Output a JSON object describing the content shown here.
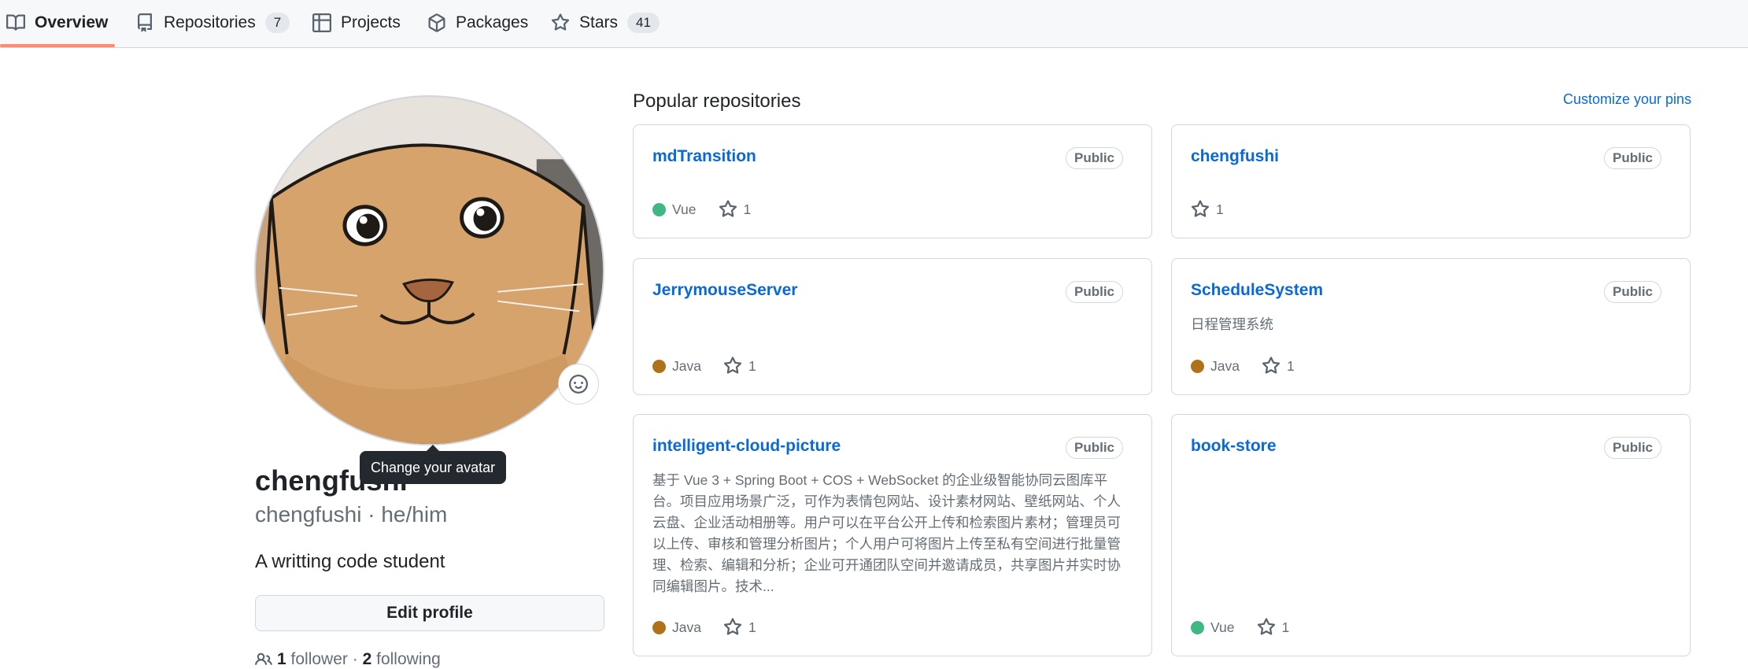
{
  "nav": {
    "tabs": [
      {
        "label": "Overview",
        "icon": "book-icon",
        "selected": true
      },
      {
        "label": "Repositories",
        "icon": "repo-icon",
        "count": "7"
      },
      {
        "label": "Projects",
        "icon": "table-icon"
      },
      {
        "label": "Packages",
        "icon": "package-icon"
      },
      {
        "label": "Stars",
        "icon": "star-icon",
        "count": "41"
      }
    ],
    "accent_color": "#fd8c73"
  },
  "profile": {
    "tooltip": "Change your avatar",
    "fullname": "chengfushi",
    "login": "chengfushi · he/him",
    "bio": "A writting code student",
    "edit_label": "Edit profile",
    "followers_count": "1",
    "followers_label": "follower",
    "separator": "·",
    "following_count": "2",
    "following_label": "following"
  },
  "popular": {
    "title": "Popular repositories",
    "customize_label": "Customize your pins",
    "repos": [
      {
        "name": "mdTransition",
        "visibility": "Public",
        "description": "",
        "language": "Vue",
        "lang_color": "#41b883",
        "stars": "1"
      },
      {
        "name": "chengfushi",
        "visibility": "Public",
        "description": "",
        "language": "",
        "lang_color": "",
        "stars": "1"
      },
      {
        "name": "JerrymouseServer",
        "visibility": "Public",
        "description": "",
        "language": "Java",
        "lang_color": "#b07219",
        "stars": "1"
      },
      {
        "name": "ScheduleSystem",
        "visibility": "Public",
        "description": "日程管理系统",
        "language": "Java",
        "lang_color": "#b07219",
        "stars": "1"
      },
      {
        "name": "intelligent-cloud-picture",
        "visibility": "Public",
        "description": "基于 Vue 3 + Spring Boot + COS + WebSocket 的企业级智能协同云图库平台。项目应用场景广泛，可作为表情包网站、设计素材网站、壁纸网站、个人云盘、企业活动相册等。用户可以在平台公开上传和检索图片素材；管理员可以上传、审核和管理分析图片；个人用户可将图片上传至私有空间进行批量管理、检索、编辑和分析；企业可开通团队空间并邀请成员，共享图片并实时协同编辑图片。技术...",
        "language": "Java",
        "lang_color": "#b07219",
        "stars": "1"
      },
      {
        "name": "book-store",
        "visibility": "Public",
        "description": "",
        "language": "Vue",
        "lang_color": "#41b883",
        "stars": "1"
      }
    ]
  }
}
